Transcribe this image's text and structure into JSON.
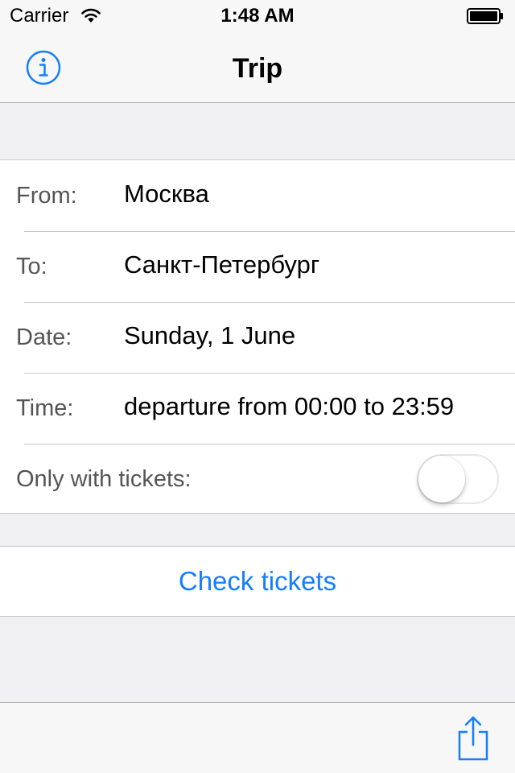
{
  "status_bar": {
    "carrier": "Carrier",
    "time": "1:48 AM"
  },
  "nav": {
    "title": "Trip",
    "left_icon": "info-icon"
  },
  "form": {
    "rows": [
      {
        "label": "From:",
        "value": "Москва"
      },
      {
        "label": "To:",
        "value": "Санкт-Петербург"
      },
      {
        "label": "Date:",
        "value": "Sunday, 1 June"
      },
      {
        "label": "Time:",
        "value": "departure from 00:00 to 23:59"
      }
    ],
    "toggle": {
      "label": "Only with tickets:",
      "on": false
    }
  },
  "action": {
    "label": "Check tickets"
  },
  "toolbar": {
    "right_icon": "share-icon"
  },
  "colors": {
    "accent": "#147efb",
    "background": "#efeff4",
    "bar": "#f7f7f7",
    "separator": "#c8c7cc"
  }
}
